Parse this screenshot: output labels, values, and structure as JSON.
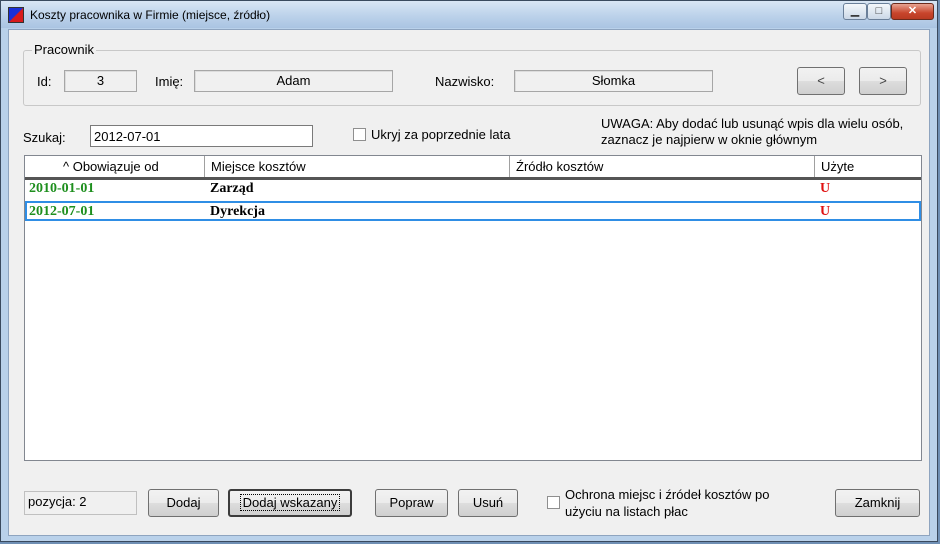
{
  "window": {
    "title": "Koszty pracownika w Firmie (miejsce, źródło)",
    "buttons": {
      "minimize": "▁",
      "maximize": "□",
      "close": "✕"
    }
  },
  "employee": {
    "group_label": "Pracownik",
    "id_label": "Id:",
    "id_value": "3",
    "first_name_label": "Imię:",
    "first_name_value": "Adam",
    "last_name_label": "Nazwisko:",
    "last_name_value": "Słomka",
    "prev_label": "<",
    "next_label": ">"
  },
  "search": {
    "label": "Szukaj:",
    "value": "2012-07-01",
    "hide_previous_label": "Ukryj za poprzednie lata",
    "hide_previous_checked": false
  },
  "notice": {
    "line1": "UWAGA:  Aby dodać lub usunąć wpis dla wielu osób,",
    "line2": "zaznacz je najpierw w oknie głównym"
  },
  "table": {
    "columns": [
      "^ Obowiązuje od",
      "Miejsce kosztów",
      "Źródło kosztów",
      "Użyte"
    ],
    "rows": [
      {
        "date": "2010-01-01",
        "place": "Zarząd",
        "source": "",
        "used": "U"
      },
      {
        "date": "2012-07-01",
        "place": "Dyrekcja",
        "source": "",
        "used": "U"
      }
    ],
    "selected_row": 1
  },
  "footer": {
    "position_text": "pozycja:  2",
    "add_label": "Dodaj",
    "add_selected_label": "Dodaj wskazany",
    "edit_label": "Popraw",
    "delete_label": "Usuń",
    "protect_line1": "Ochrona miejsc i źródeł kosztów po",
    "protect_line2": "użyciu na listach płac",
    "protect_checked": false,
    "close_label": "Zamknij"
  },
  "colors": {
    "date_text": "#1e8f1e",
    "used_text": "#e01010",
    "selection_border": "#2f8ee5"
  }
}
